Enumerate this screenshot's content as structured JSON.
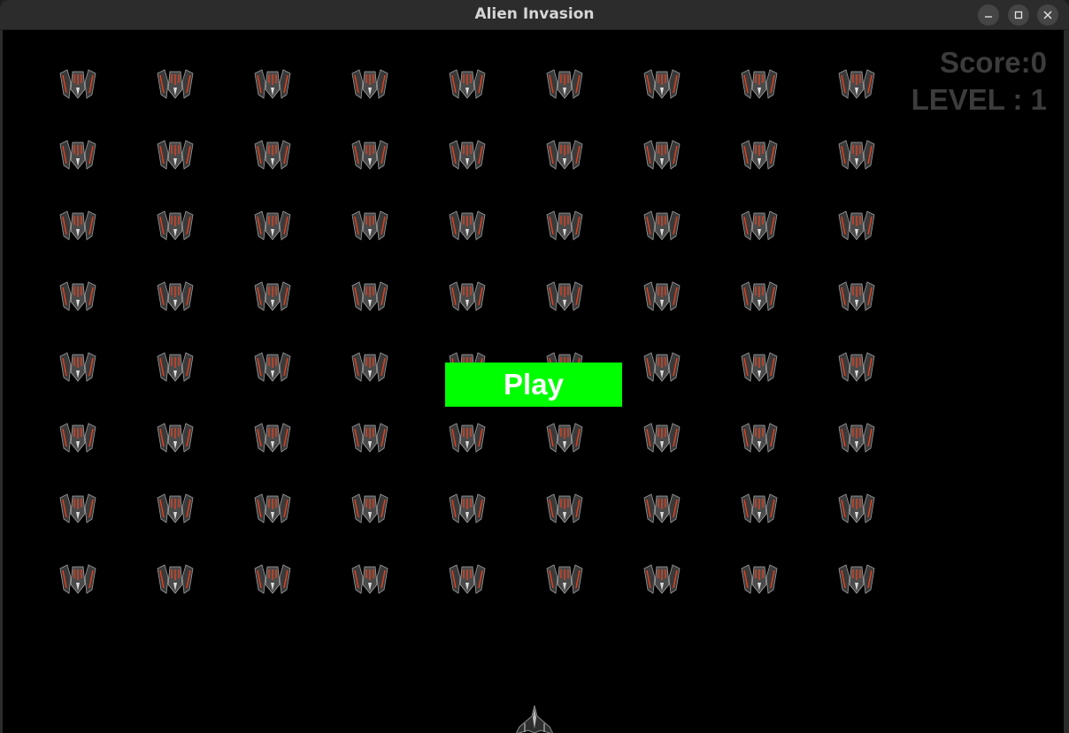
{
  "window": {
    "title": "Alien Invasion",
    "controls": [
      "minimize-icon",
      "maximize-icon",
      "close-icon"
    ]
  },
  "hud": {
    "score_text": "Score:0",
    "level_text": "LEVEL : 1"
  },
  "play_button": {
    "label": "Play",
    "color": "#00ff00"
  },
  "fleet": {
    "rows": 8,
    "columns": 9,
    "alien_icon": "alien-ship-icon"
  },
  "player": {
    "icon": "player-ship-icon"
  },
  "colors": {
    "background": "#000000",
    "hud_text": "#3c3c3c",
    "alien_accent": "#e8401c"
  }
}
